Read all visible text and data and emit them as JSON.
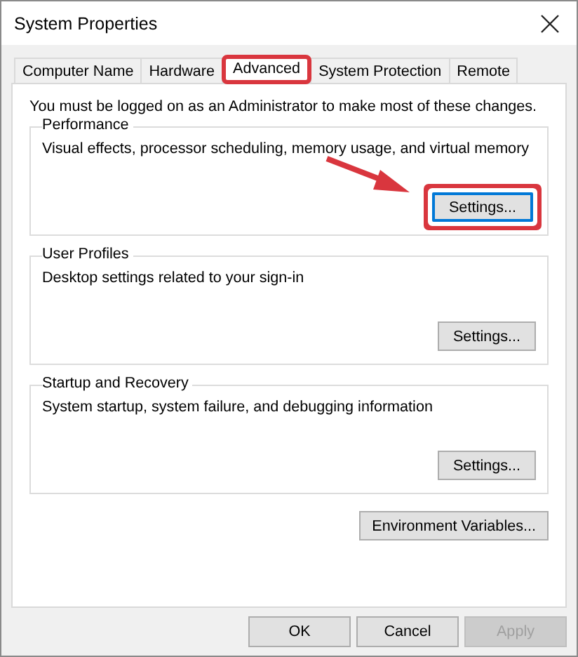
{
  "window": {
    "title": "System Properties"
  },
  "tabs": [
    {
      "label": "Computer Name",
      "selected": false,
      "highlighted": false
    },
    {
      "label": "Hardware",
      "selected": false,
      "highlighted": false
    },
    {
      "label": "Advanced",
      "selected": true,
      "highlighted": true
    },
    {
      "label": "System Protection",
      "selected": false,
      "highlighted": false
    },
    {
      "label": "Remote",
      "selected": false,
      "highlighted": false
    }
  ],
  "notice": "You must be logged on as an Administrator to make most of these changes.",
  "groups": [
    {
      "title": "Performance",
      "description": "Visual effects, processor scheduling, memory usage, and virtual memory",
      "button": {
        "label": "Settings...",
        "focused": true,
        "highlighted": true
      }
    },
    {
      "title": "User Profiles",
      "description": "Desktop settings related to your sign-in",
      "button": {
        "label": "Settings...",
        "focused": false,
        "highlighted": false
      }
    },
    {
      "title": "Startup and Recovery",
      "description": "System startup, system failure, and debugging information",
      "button": {
        "label": "Settings...",
        "focused": false,
        "highlighted": false
      }
    }
  ],
  "environment_button": "Environment Variables...",
  "footer_buttons": [
    {
      "label": "OK",
      "disabled": false
    },
    {
      "label": "Cancel",
      "disabled": false
    },
    {
      "label": "Apply",
      "disabled": true
    }
  ]
}
